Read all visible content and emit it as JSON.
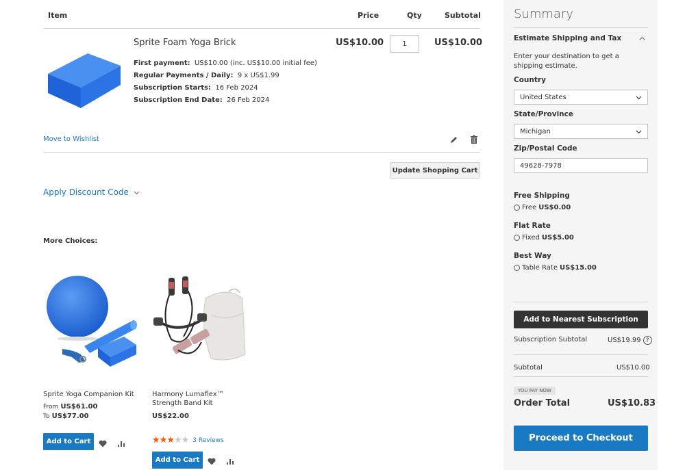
{
  "cart": {
    "headers": {
      "item": "Item",
      "price": "Price",
      "qty": "Qty",
      "subtotal": "Subtotal"
    },
    "item": {
      "name": "Sprite Foam Yoga Brick",
      "price": "US$10.00",
      "qty": "1",
      "subtotal": "US$10.00",
      "options": [
        {
          "label": "First payment:",
          "value": "US$10.00 (inc. US$10.00 initial fee)"
        },
        {
          "label": "Regular Payments / Daily:",
          "value": "9 x US$1.99"
        },
        {
          "label": "Subscription Starts:",
          "value": "16 Feb 2024"
        },
        {
          "label": "Subscription End Date:",
          "value": "26 Feb 2024"
        }
      ],
      "move_to_wishlist": "Move to Wishlist"
    },
    "update_button": "Update Shopping Cart",
    "discount_label": "Apply Discount Code"
  },
  "more_choices": {
    "title": "More Choices:",
    "products": [
      {
        "name": "Sprite Yoga Companion Kit",
        "from_label": "From",
        "from_price": "US$61.00",
        "to_label": "To",
        "to_price": "US$77.00",
        "add_to_cart": "Add to Cart"
      },
      {
        "name": "Harmony Lumaflex™ Strength Band Kit",
        "price": "US$22.00",
        "rating": 3,
        "reviews": "3  Reviews",
        "add_to_cart": "Add to Cart"
      }
    ]
  },
  "summary": {
    "title": "Summary",
    "estimate_title": "Estimate Shipping and Tax",
    "estimate_text": "Enter your destination to get a shipping estimate.",
    "country_label": "Country",
    "country_value": "United States",
    "state_label": "State/Province",
    "state_value": "Michigan",
    "zip_label": "Zip/Postal Code",
    "zip_value": "49628-7978",
    "shipping": [
      {
        "title": "Free Shipping",
        "method": "Free",
        "price": "US$0.00"
      },
      {
        "title": "Flat Rate",
        "method": "Fixed",
        "price": "US$5.00"
      },
      {
        "title": "Best Way",
        "method": "Table Rate",
        "price": "US$15.00"
      }
    ],
    "subscription_button": "Add to Nearest Subscription",
    "subscription_subtotal_label": "Subscription Subtotal",
    "subscription_subtotal_value": "US$19.99",
    "subtotal_label": "Subtotal",
    "subtotal_value": "US$10.00",
    "you_pay_now": "YOU PAY NOW",
    "order_total_label": "Order Total",
    "order_total_value": "US$10.83",
    "checkout_button": "Proceed to Checkout"
  },
  "colors": {
    "accent": "#1979c3",
    "dark_button": "#333333",
    "summary_bg": "#f5f5f5",
    "star": "#ff5501"
  }
}
